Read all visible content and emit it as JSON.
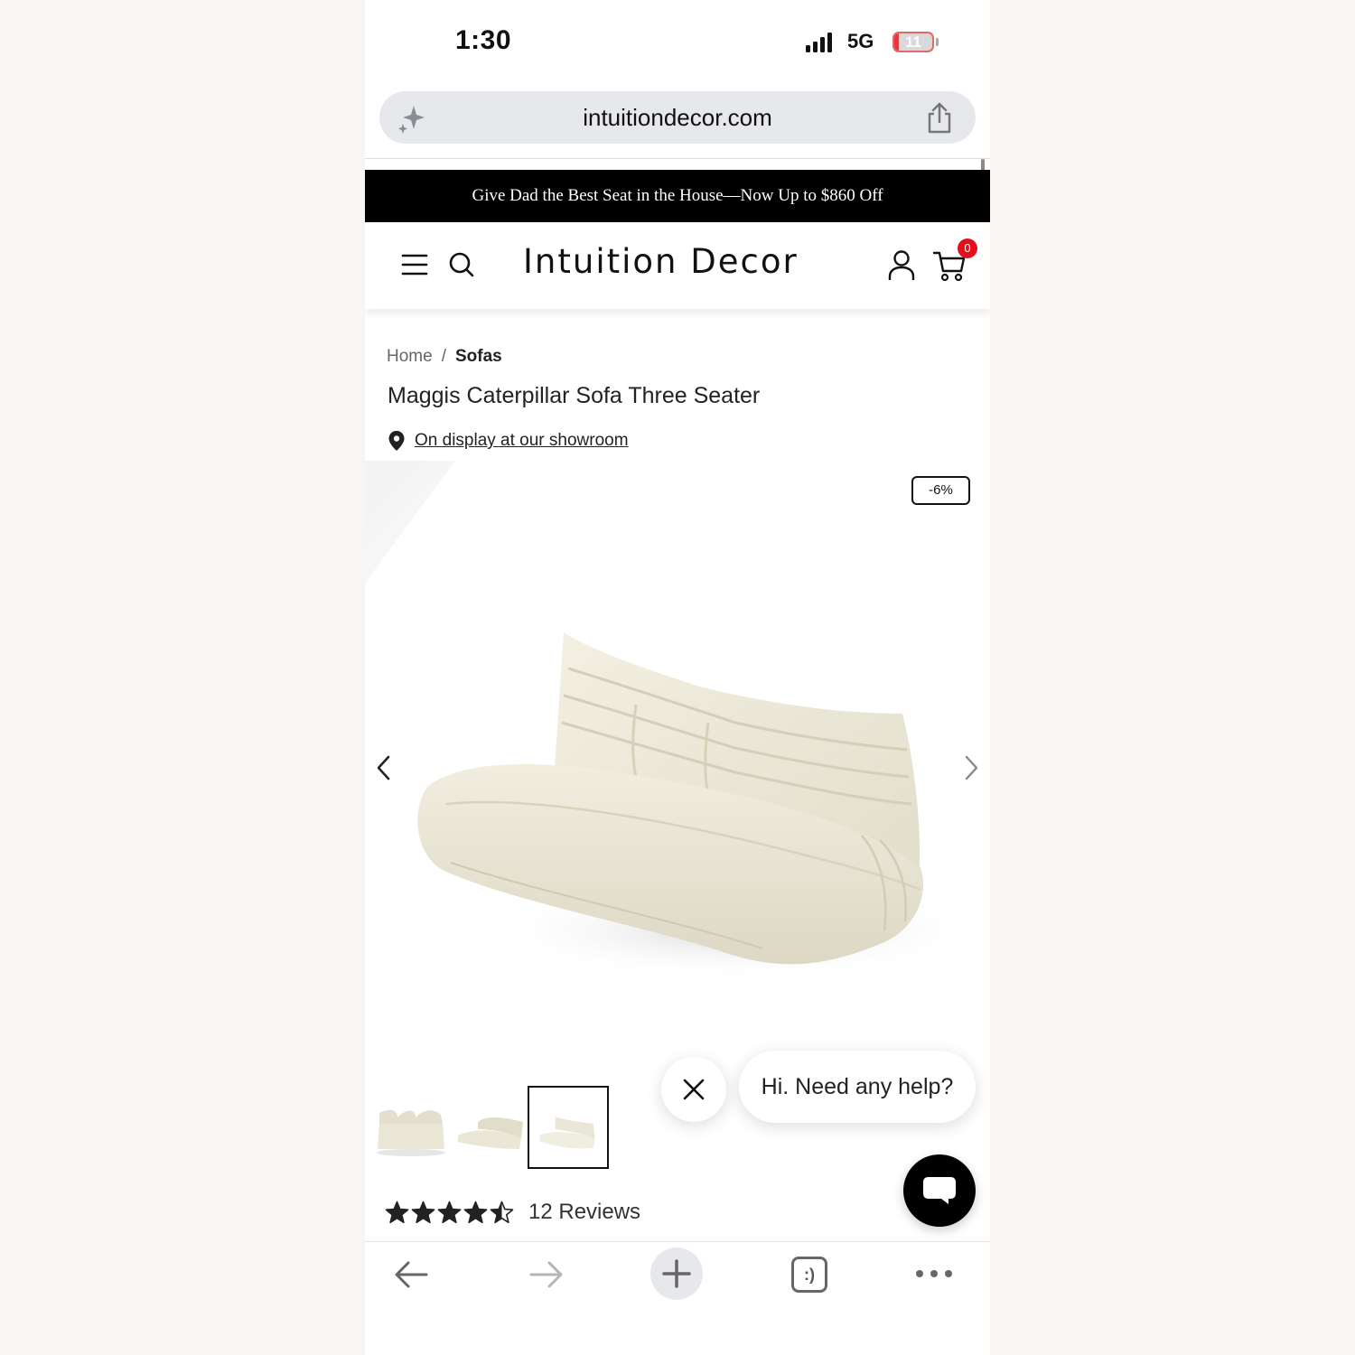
{
  "status_bar": {
    "time": "1:30",
    "network": "5G",
    "battery": "11",
    "battery_level": 0.11
  },
  "browser": {
    "url": "intuitiondecor.com"
  },
  "promo": {
    "text": "Give Dad the Best Seat in the House—Now Up to $860 Off"
  },
  "header": {
    "logo": "Intuition Decor",
    "cart_count": "0"
  },
  "breadcrumb": {
    "home": "Home",
    "separator": "/",
    "current": "Sofas"
  },
  "product": {
    "title": "Maggis Caterpillar Sofa Three Seater",
    "showroom_link": "On display at our showroom",
    "discount": "-6%",
    "rating": 4.5,
    "reviews": "12 Reviews"
  },
  "chat": {
    "bubble": "Hi. Need any help?"
  },
  "toolbar": {
    "tabs_label": ":)"
  },
  "colors": {
    "promo_bg": "#000000",
    "cart_badge": "#e3101c",
    "sofa": "#ece8d8"
  }
}
